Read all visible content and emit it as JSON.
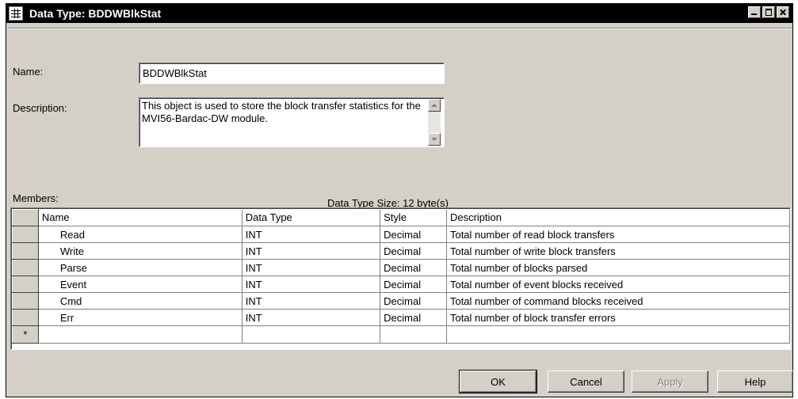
{
  "window": {
    "title": "Data Type:  BDDWBlkStat"
  },
  "form": {
    "name_label": "Name:",
    "name_value": "BDDWBlkStat",
    "description_label": "Description:",
    "description_value": "This object is used to store the block transfer statistics for the MVI56-Bardac-DW module."
  },
  "members": {
    "label": "Members:",
    "size_text": "Data Type Size: 12 byte(s)",
    "columns": [
      "Name",
      "Data Type",
      "Style",
      "Description"
    ],
    "rows": [
      {
        "name": "Read",
        "type": "INT",
        "style": "Decimal",
        "description": "Total number of read block transfers"
      },
      {
        "name": "Write",
        "type": "INT",
        "style": "Decimal",
        "description": "Total number of write block transfers"
      },
      {
        "name": "Parse",
        "type": "INT",
        "style": "Decimal",
        "description": "Total number of blocks parsed"
      },
      {
        "name": "Event",
        "type": "INT",
        "style": "Decimal",
        "description": "Total number of event blocks received"
      },
      {
        "name": "Cmd",
        "type": "INT",
        "style": "Decimal",
        "description": "Total number of command blocks received"
      },
      {
        "name": "Err",
        "type": "INT",
        "style": "Decimal",
        "description": "Total number of block transfer errors"
      }
    ],
    "new_row_marker": "*"
  },
  "buttons": {
    "ok": "OK",
    "cancel": "Cancel",
    "apply": "Apply",
    "help": "Help"
  }
}
